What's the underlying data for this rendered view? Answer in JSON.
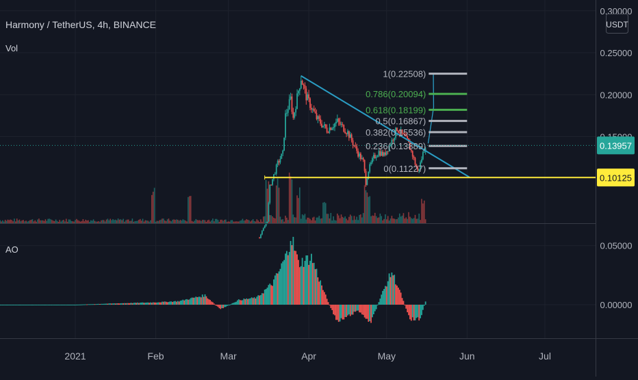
{
  "header": {
    "title": "Harmony / TetherUS, 4h, BINANCE",
    "vol_label": "Vol",
    "ao_label": "AO",
    "currency_button": "USDT"
  },
  "colors": {
    "background": "#131722",
    "grid": "#1e222d",
    "axis_text": "#b2b5be",
    "up": "#26a69a",
    "down": "#ef5350",
    "ao_up": "#26a69a",
    "ao_down": "#ef5350",
    "trendline": "#2a9dc4",
    "support_line": "#ffeb3b",
    "fib_gray": "#b2b5be",
    "fib_green": "#4caf50",
    "current_price_bg": "#26a69a"
  },
  "chart_data": [
    {
      "type": "line",
      "panel": "price",
      "symbol": "Harmony / TetherUS",
      "interval": "4h",
      "exchange": "BINANCE",
      "x_ticks": [
        "2021",
        "Feb",
        "Mar",
        "Apr",
        "May",
        "Jun",
        "Jul"
      ],
      "y_ticks": [
        "0.30000",
        "0.25000",
        "0.20000",
        "0.15000"
      ],
      "ylim": [
        0.085,
        0.3
      ],
      "grid": true,
      "current_price": "0.13957",
      "current_price_value": 0.13957,
      "support_label": "0.10125",
      "support_value": 0.10125,
      "price_path": [
        [
          "2021-01-01",
          0.02
        ],
        [
          "2021-03-13",
          0.03
        ],
        [
          "2021-03-16",
          0.05
        ],
        [
          "2021-03-17",
          0.09
        ],
        [
          "2021-03-20",
          0.118
        ],
        [
          "2021-03-22",
          0.13
        ],
        [
          "2021-03-23",
          0.175
        ],
        [
          "2021-03-25",
          0.195
        ],
        [
          "2021-03-26",
          0.172
        ],
        [
          "2021-03-28",
          0.205
        ],
        [
          "2021-03-29",
          0.22
        ],
        [
          "2021-03-31",
          0.198
        ],
        [
          "2021-04-04",
          0.172
        ],
        [
          "2021-04-08",
          0.158
        ],
        [
          "2021-04-12",
          0.168
        ],
        [
          "2021-04-16",
          0.155
        ],
        [
          "2021-04-20",
          0.13
        ],
        [
          "2021-04-22",
          0.12
        ],
        [
          "2021-04-23",
          0.095
        ],
        [
          "2021-04-24",
          0.11
        ],
        [
          "2021-04-26",
          0.125
        ],
        [
          "2021-04-28",
          0.132
        ],
        [
          "2021-04-30",
          0.128
        ],
        [
          "2021-05-03",
          0.145
        ],
        [
          "2021-05-05",
          0.16
        ],
        [
          "2021-05-07",
          0.152
        ],
        [
          "2021-05-09",
          0.145
        ],
        [
          "2021-05-11",
          0.128
        ],
        [
          "2021-05-13",
          0.108
        ],
        [
          "2021-05-14",
          0.118
        ],
        [
          "2021-05-15",
          0.13
        ],
        [
          "2021-05-16",
          0.1396
        ]
      ],
      "trendline": {
        "from": [
          "2021-03-29",
          0.2225
        ],
        "to": [
          "2021-06-02",
          0.1015
        ]
      },
      "support_line": {
        "from": [
          "2021-03-15",
          0.10125
        ],
        "to": [
          "2021-07-31",
          0.10125
        ]
      },
      "projection": {
        "from": [
          "2021-05-17",
          0.142
        ],
        "to": [
          "2021-05-19",
          0.2255
        ]
      },
      "fib_retracement": [
        {
          "label": "1(0.22508)",
          "value": 0.22508,
          "color": "gray"
        },
        {
          "label": "0.786(0.20094)",
          "value": 0.20094,
          "color": "green"
        },
        {
          "label": "0.618(0.18199)",
          "value": 0.18199,
          "color": "green"
        },
        {
          "label": "0.5(0.16867)",
          "value": 0.16867,
          "color": "gray"
        },
        {
          "label": "0.382(0.15536)",
          "value": 0.15536,
          "color": "gray"
        },
        {
          "label": "0.236(0.13889)",
          "value": 0.13889,
          "color": "gray"
        },
        {
          "label": "0(0.11227)",
          "value": 0.11227,
          "color": "gray"
        }
      ],
      "fib_range": [
        "2021-05-13",
        "2021-06-01"
      ]
    },
    {
      "type": "bar",
      "panel": "volume",
      "name": "Vol",
      "note": "relative volume spikes",
      "spikes": [
        [
          "2021-01-31",
          0.75
        ],
        [
          "2021-02-14",
          0.55
        ],
        [
          "2021-03-16",
          0.85
        ],
        [
          "2021-03-20",
          0.95
        ],
        [
          "2021-03-25",
          1.0
        ],
        [
          "2021-03-28",
          0.7
        ],
        [
          "2021-04-07",
          0.45
        ],
        [
          "2021-04-23",
          0.8
        ],
        [
          "2021-04-24",
          0.55
        ],
        [
          "2021-05-15",
          0.5
        ]
      ]
    },
    {
      "type": "bar",
      "panel": "ao",
      "name": "AO",
      "y_ticks": [
        "0.05000",
        "0.00000"
      ],
      "ylim": [
        -0.03,
        0.062
      ],
      "waves": [
        [
          "2021-01-01",
          0.0
        ],
        [
          "2021-01-15",
          0.001
        ],
        [
          "2021-02-01",
          0.002
        ],
        [
          "2021-02-10",
          0.003
        ],
        [
          "2021-02-20",
          0.008
        ],
        [
          "2021-02-26",
          -0.004
        ],
        [
          "2021-03-05",
          0.004
        ],
        [
          "2021-03-12",
          0.006
        ],
        [
          "2021-03-18",
          0.018
        ],
        [
          "2021-03-21",
          0.03
        ],
        [
          "2021-03-24",
          0.045
        ],
        [
          "2021-03-25",
          0.06
        ],
        [
          "2021-03-28",
          0.035
        ],
        [
          "2021-04-02",
          0.04
        ],
        [
          "2021-04-07",
          0.01
        ],
        [
          "2021-04-12",
          -0.015
        ],
        [
          "2021-04-16",
          -0.01
        ],
        [
          "2021-04-20",
          -0.005
        ],
        [
          "2021-04-25",
          -0.015
        ],
        [
          "2021-04-29",
          0.008
        ],
        [
          "2021-05-03",
          0.028
        ],
        [
          "2021-05-06",
          0.012
        ],
        [
          "2021-05-10",
          -0.012
        ],
        [
          "2021-05-14",
          -0.012
        ],
        [
          "2021-05-16",
          0.003
        ]
      ]
    }
  ]
}
